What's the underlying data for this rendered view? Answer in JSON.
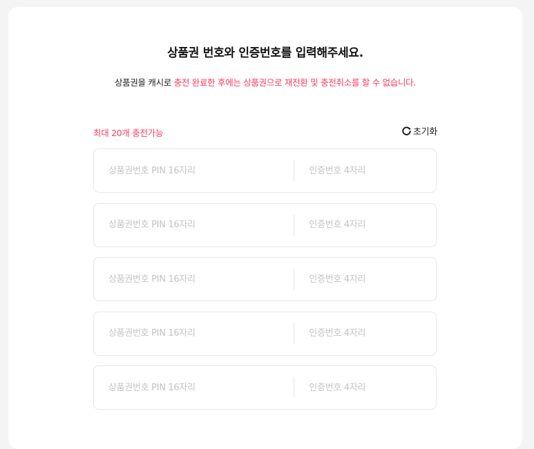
{
  "header": {
    "title": "상품권 번호와 인증번호를 입력해주세요.",
    "notice_prefix": "상품권을 캐시로",
    "notice_highlight": "충전 완료한 후에는 상품권으로 재전환 및 충전취소를 할 수 없습니다."
  },
  "form": {
    "limit_text": "최대 20개 충전가능",
    "reset_label": "초기화",
    "reset_icon": "refresh-icon",
    "rows": [
      {
        "pin_placeholder": "상품권번호 PIN 16자리",
        "auth_placeholder": "인증번호 4자리",
        "pin_value": "",
        "auth_value": ""
      },
      {
        "pin_placeholder": "상품권번호 PIN 16자리",
        "auth_placeholder": "인증번호 4자리",
        "pin_value": "",
        "auth_value": ""
      },
      {
        "pin_placeholder": "상품권번호 PIN 16자리",
        "auth_placeholder": "인증번호 4자리",
        "pin_value": "",
        "auth_value": ""
      },
      {
        "pin_placeholder": "상품권번호 PIN 16자리",
        "auth_placeholder": "인증번호 4자리",
        "pin_value": "",
        "auth_value": ""
      },
      {
        "pin_placeholder": "상품권번호 PIN 16자리",
        "auth_placeholder": "인증번호 4자리",
        "pin_value": "",
        "auth_value": ""
      }
    ]
  },
  "colors": {
    "accent": "#ff3b5c",
    "text": "#111111",
    "border": "#e6e6e6",
    "placeholder": "#c3c3c3"
  }
}
